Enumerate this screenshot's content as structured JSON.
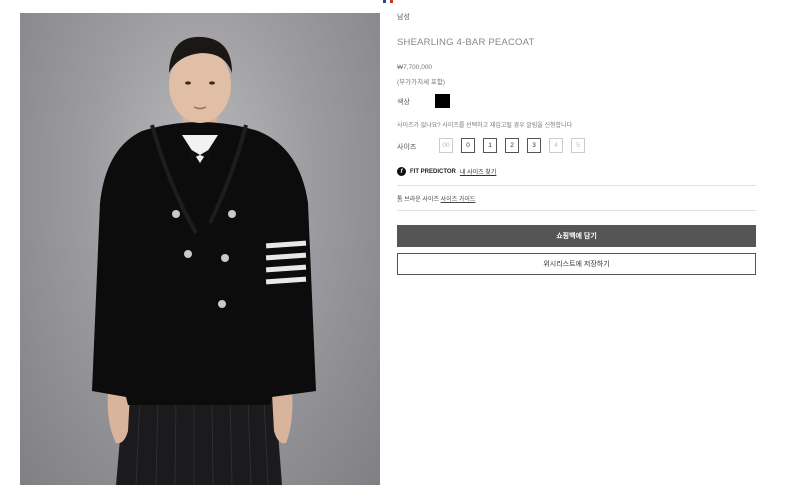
{
  "brand_mark": {
    "colors": [
      "#2b4a8a",
      "#ffffff",
      "#c0392b"
    ]
  },
  "product": {
    "category": "남성",
    "name": "SHEARLING 4-BAR PEACOAT",
    "price": "₩7,700,000",
    "vat_note": "(부가가치세 포함)",
    "image_icon": "product-photo-peacoat"
  },
  "color": {
    "label": "색상",
    "selected": "#000000"
  },
  "size": {
    "notice": "사이즈가 없나요? 사이즈를 선택하고 재입고될 경우 알림을 신청합니다",
    "label": "사이즈",
    "options": [
      {
        "label": "00",
        "available": false
      },
      {
        "label": "0",
        "available": true
      },
      {
        "label": "1",
        "available": true
      },
      {
        "label": "2",
        "available": true
      },
      {
        "label": "3",
        "available": true
      },
      {
        "label": "4",
        "available": false
      },
      {
        "label": "5",
        "available": false
      }
    ]
  },
  "fit_predictor": {
    "icon_letter": "f",
    "title": "FIT PREDICTOR",
    "link": "내 사이즈 찾기"
  },
  "size_guide": {
    "prefix": "톰 브라운 사이즈",
    "link": "사이즈 가이드"
  },
  "actions": {
    "add_to_cart": "쇼핑백에 담기",
    "wishlist": "위시리스트에 저장하기"
  }
}
